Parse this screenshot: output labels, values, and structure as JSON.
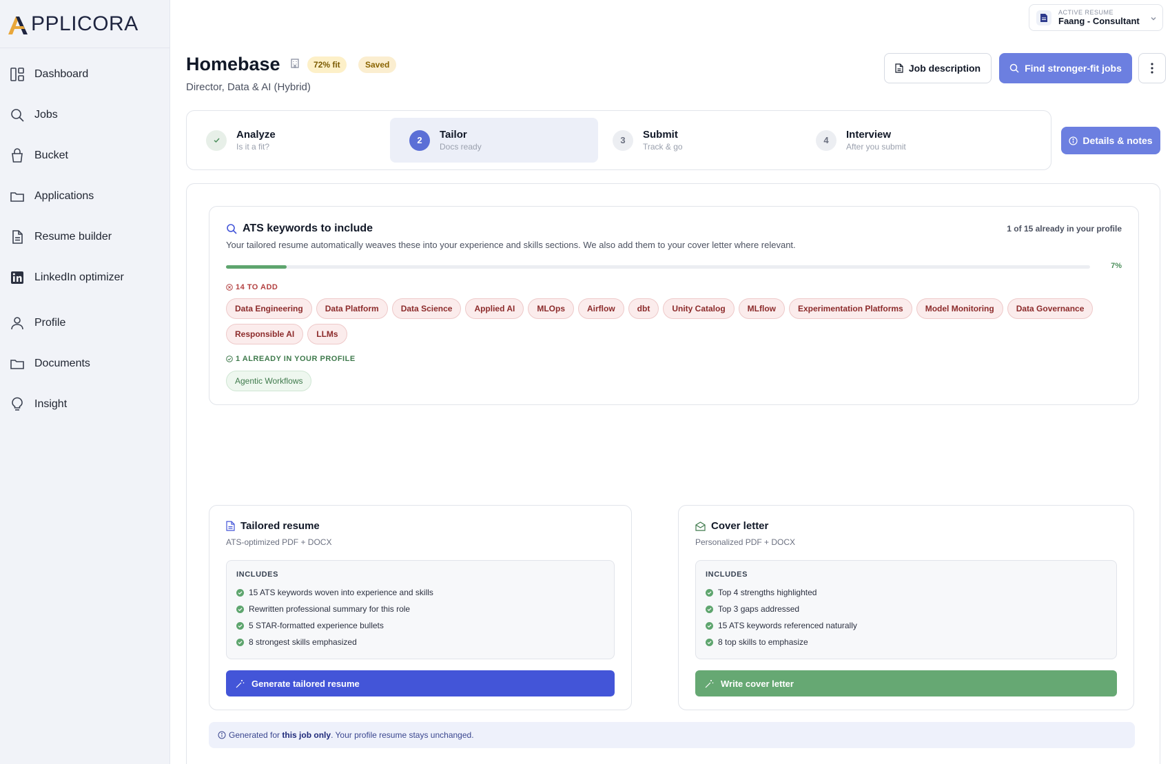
{
  "brand": {
    "logo_text": "PPLICORA"
  },
  "sidebar": {
    "items": [
      {
        "label": "Dashboard",
        "icon": "dashboard-icon"
      },
      {
        "label": "Jobs",
        "icon": "search-icon"
      },
      {
        "label": "Bucket",
        "icon": "bucket-icon"
      },
      {
        "label": "Applications",
        "icon": "folder-icon"
      },
      {
        "label": "Resume builder",
        "icon": "document-icon"
      },
      {
        "label": "LinkedIn optimizer",
        "icon": "linkedin-icon"
      },
      {
        "label": "Profile",
        "icon": "user-icon"
      },
      {
        "label": "Documents",
        "icon": "folder-icon"
      },
      {
        "label": "Insight",
        "icon": "lightbulb-icon"
      }
    ]
  },
  "active_resume": {
    "label": "ACTIVE RESUME",
    "name": "Faang - Consultant"
  },
  "header": {
    "title": "Homebase",
    "fit_badge": "72% fit",
    "saved_badge": "Saved",
    "subtitle": "Director, Data & AI (Hybrid)",
    "job_description_label": "Job description",
    "find_label": "Find stronger-fit jobs"
  },
  "steps": [
    {
      "num": "",
      "title": "Analyze",
      "sub": "Is it a fit?",
      "state": "done"
    },
    {
      "num": "2",
      "title": "Tailor",
      "sub": "Docs ready",
      "state": "current"
    },
    {
      "num": "3",
      "title": "Submit",
      "sub": "Track & go",
      "state": "todo"
    },
    {
      "num": "4",
      "title": "Interview",
      "sub": "After you submit",
      "state": "todo"
    }
  ],
  "details_label": "Details & notes",
  "ats": {
    "title": "ATS keywords to include",
    "count": "1 of 15 already in your profile",
    "description": "Your tailored resume automatically weaves these into your experience and skills sections. We also add them to your cover letter where relevant.",
    "progress_fraction": 0.07,
    "progress_text": "7%",
    "to_add_label": "14 TO ADD",
    "to_add": [
      "Data Engineering",
      "Data Platform",
      "Data Science",
      "Applied AI",
      "MLOps",
      "Airflow",
      "dbt",
      "Unity Catalog",
      "MLflow",
      "Experimentation Platforms",
      "Model Monitoring",
      "Data Governance",
      "Responsible AI",
      "LLMs"
    ],
    "have_label": "1 ALREADY IN YOUR PROFILE",
    "have": [
      "Agentic Workflows"
    ]
  },
  "resume_card": {
    "title": "Tailored resume",
    "sub": "ATS-optimized PDF + DOCX",
    "includes_label": "INCLUDES",
    "items": [
      "15 ATS keywords woven into experience and skills",
      "Rewritten professional summary for this role",
      "5 STAR-formatted experience bullets",
      "8 strongest skills emphasized"
    ],
    "button": "Generate tailored resume"
  },
  "cover_card": {
    "title": "Cover letter",
    "sub": "Personalized PDF + DOCX",
    "includes_label": "INCLUDES",
    "items": [
      "Top 4 strengths highlighted",
      "Top 3 gaps addressed",
      "15 ATS keywords referenced naturally",
      "8 top skills to emphasize"
    ],
    "button": "Write cover letter"
  },
  "note": {
    "prefix": "Generated for ",
    "bold": "this job only",
    "suffix": ". Your profile resume stays unchanged."
  },
  "colors": {
    "accent": "#6c7fe0",
    "primary_button": "#4355d8",
    "success": "#5ea56e",
    "danger_chip": "#fbecec"
  }
}
